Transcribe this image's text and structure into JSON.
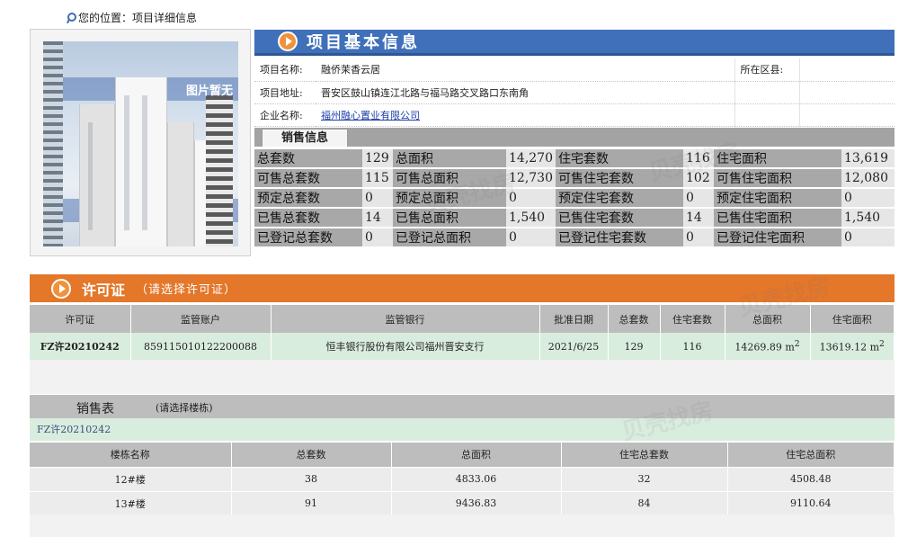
{
  "breadcrumb": {
    "text": "您的位置：项目详细信息",
    "icon": "location-pin-icon"
  },
  "photo": {
    "placeholder_text": "图片暂无"
  },
  "basic_info": {
    "title": "项目基本信息",
    "project_name_label": "项目名称:",
    "project_name": "融侨茉香云居",
    "district_label": "所在区县:",
    "district": "",
    "address_label": "项目地址:",
    "address": "晋安区鼓山镇连江北路与福马路交叉路口东南角",
    "company_label": "企业名称:",
    "company": "福州融心置业有限公司"
  },
  "sales_info": {
    "tab_label": "销售信息",
    "rows": [
      [
        {
          "k": "总套数",
          "v": "129"
        },
        {
          "k": "总面积",
          "v": "14,270"
        },
        {
          "k": "住宅套数",
          "v": "116"
        },
        {
          "k": "住宅面积",
          "v": "13,619"
        }
      ],
      [
        {
          "k": "可售总套数",
          "v": "115"
        },
        {
          "k": "可售总面积",
          "v": "12,730"
        },
        {
          "k": "可售住宅套数",
          "v": "102"
        },
        {
          "k": "可售住宅面积",
          "v": "12,080"
        }
      ],
      [
        {
          "k": "预定总套数",
          "v": "0"
        },
        {
          "k": "预定总面积",
          "v": "0"
        },
        {
          "k": "预定住宅套数",
          "v": "0"
        },
        {
          "k": "预定住宅面积",
          "v": "0"
        }
      ],
      [
        {
          "k": "已售总套数",
          "v": "14"
        },
        {
          "k": "已售总面积",
          "v": "1,540"
        },
        {
          "k": "已售住宅套数",
          "v": "14"
        },
        {
          "k": "已售住宅面积",
          "v": "1,540"
        }
      ],
      [
        {
          "k": "已登记总套数",
          "v": "0"
        },
        {
          "k": "已登记总面积",
          "v": "0"
        },
        {
          "k": "已登记住宅套数",
          "v": "0"
        },
        {
          "k": "已登记住宅面积",
          "v": "0"
        }
      ]
    ]
  },
  "permit": {
    "title": "许可证",
    "subtitle": "（请选择许可证）",
    "columns": [
      "许可证",
      "监管账户",
      "监管银行",
      "批准日期",
      "总套数",
      "住宅套数",
      "总面积",
      "住宅面积"
    ],
    "rows": [
      {
        "permit_no": "FZ许20210242",
        "account": "859115010122200088",
        "bank": "恒丰银行股份有限公司福州晋安支行",
        "date": "2021/6/25",
        "total_units": "129",
        "res_units": "116",
        "total_area": "14269.89 m",
        "res_area": "13619.12 m",
        "unit_sup": "2"
      }
    ]
  },
  "sales_table": {
    "title": "销售表",
    "subtitle": "(请选择楼栋)",
    "permit_no": "FZ许20210242",
    "columns": [
      "楼栋名称",
      "总套数",
      "总面积",
      "住宅总套数",
      "住宅总面积"
    ],
    "rows": [
      {
        "name": "12#楼",
        "units": "38",
        "area": "4833.06",
        "res_units": "32",
        "res_area": "4508.48"
      },
      {
        "name": "13#楼",
        "units": "91",
        "area": "9436.83",
        "res_units": "84",
        "res_area": "9110.64"
      }
    ]
  },
  "watermark": {
    "text": "贝壳找房"
  },
  "colors": {
    "blue_header": "#3f70b9",
    "orange_header": "#e4772a",
    "green_row": "#d9eddf",
    "gray_label": "#a8a8a8"
  }
}
